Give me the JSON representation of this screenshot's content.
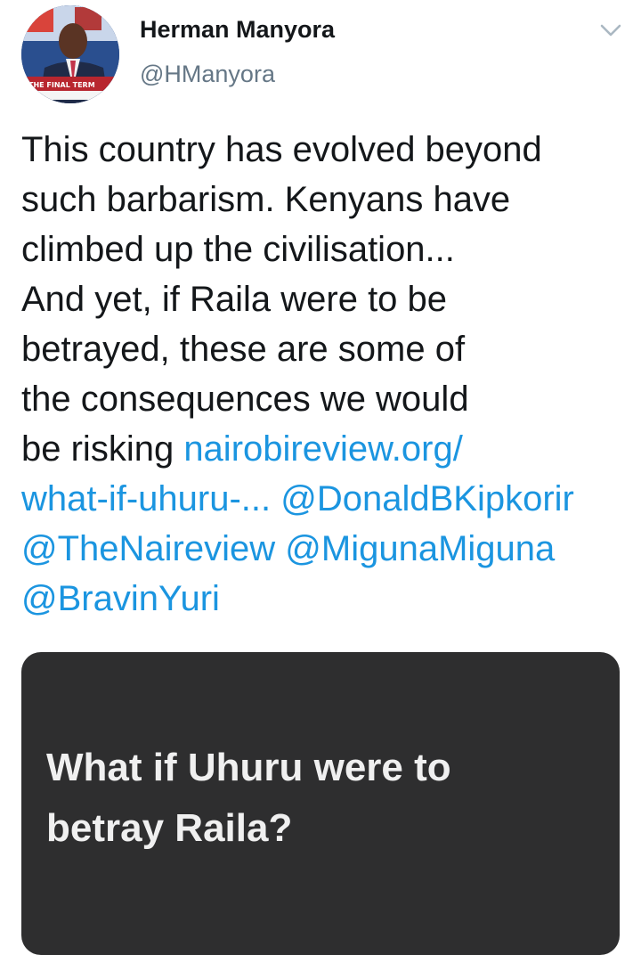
{
  "tweet": {
    "author": {
      "name": "Herman Manyora",
      "handle": "@HManyora",
      "avatar_caption": "THE FINAL TERM"
    },
    "menu_icon": "chevron-down-icon",
    "text": {
      "line1": "This country has evolved beyond",
      "line2": "such barbarism. Kenyans have",
      "line3": "climbed up the civilisation...",
      "line4": "And yet, if Raila were to be",
      "line5": "betrayed, these are some of",
      "line6": "the consequences we would",
      "line7_prefix": "be risking ",
      "link_part1": "nairobireview.org/",
      "link_part2": "what-if-uhuru-...",
      "mention1": "@DonaldBKipkorir",
      "mention2": "@TheNaireview",
      "mention3": "@MigunaMiguna",
      "mention4": "@BravinYuri"
    },
    "card": {
      "title_line1": "What if Uhuru were to",
      "title_line2": "betray Raila?"
    }
  },
  "colors": {
    "link": "#1b95e0",
    "handle": "#657786",
    "card_bg": "#2e2e2f",
    "text": "#14171a"
  }
}
